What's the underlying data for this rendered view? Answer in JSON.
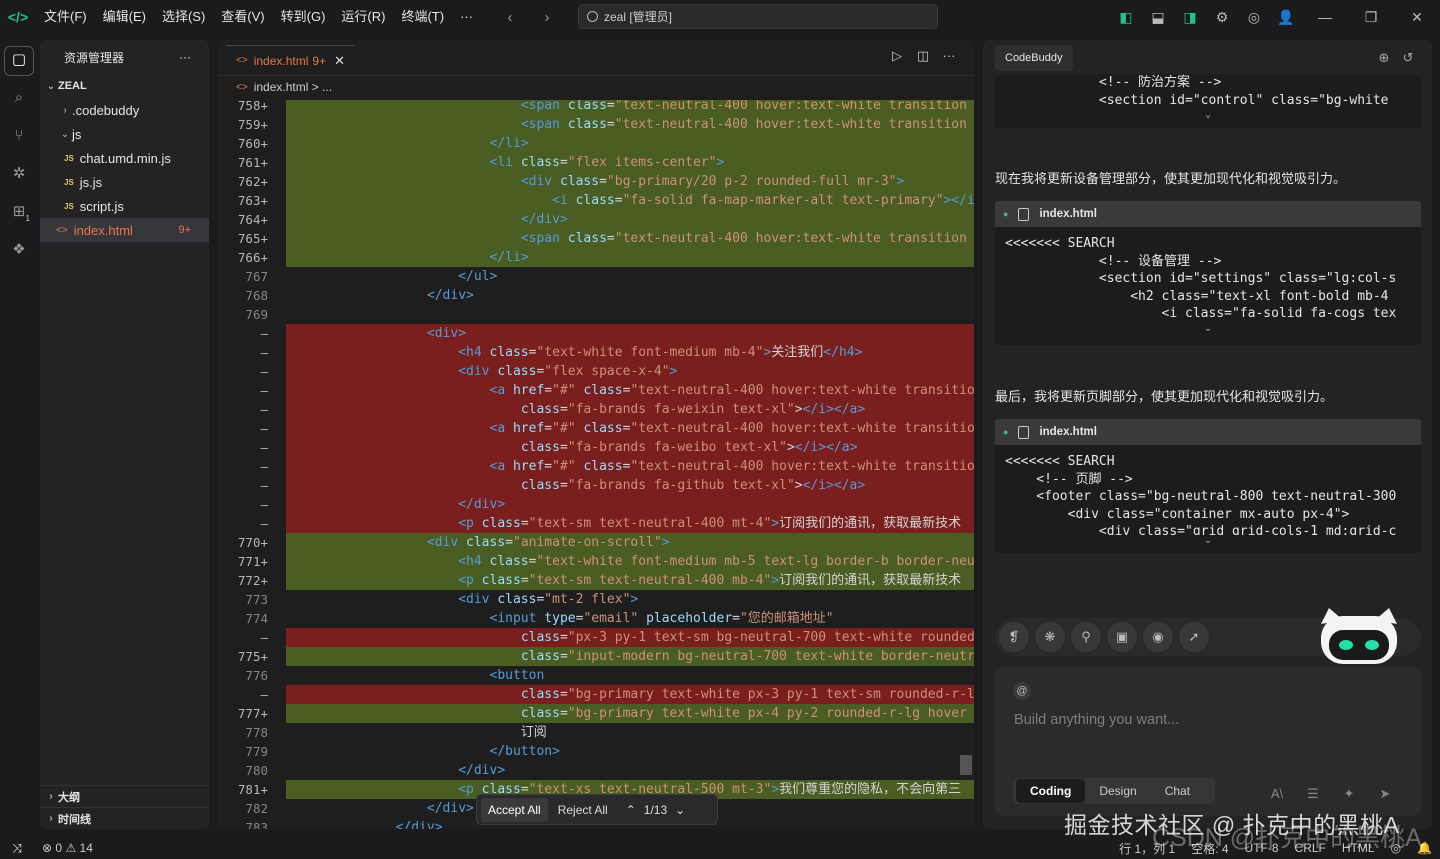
{
  "titlebar": {
    "menus": [
      "文件(F)",
      "编辑(E)",
      "选择(S)",
      "查看(V)",
      "转到(G)",
      "运行(R)",
      "终端(T)",
      "···"
    ],
    "search": "zeal [管理员]"
  },
  "explorer": {
    "title": "资源管理器",
    "more": "···",
    "root": "ZEAL",
    "items": [
      {
        "label": ".codebuddy",
        "type": "folder",
        "indent": 1,
        "open": false
      },
      {
        "label": "js",
        "type": "folder",
        "indent": 1,
        "open": true
      },
      {
        "label": "chat.umd.min.js",
        "type": "js",
        "indent": 2
      },
      {
        "label": "js.js",
        "type": "js",
        "indent": 2
      },
      {
        "label": "script.js",
        "type": "js",
        "indent": 2
      },
      {
        "label": "index.html",
        "type": "html",
        "indent": 1,
        "selected": true,
        "count": "9+"
      }
    ],
    "outline": "大纲",
    "timeline": "时间线"
  },
  "editor": {
    "tab_label": "index.html",
    "tab_count": "9+",
    "breadcrumb": "index.html > ...",
    "lines": [
      {
        "n": "758+",
        "k": "add",
        "h": "                              <span class=\"text-neutral-400 hover:text-white transition"
      },
      {
        "n": "759+",
        "k": "add",
        "h": "                              <span class=\"text-neutral-400 hover:text-white transition"
      },
      {
        "n": "760+",
        "k": "add",
        "h": "                          </li>"
      },
      {
        "n": "761+",
        "k": "add",
        "h": "                          <li class=\"flex items-center\">"
      },
      {
        "n": "762+",
        "k": "add",
        "h": "                              <div class=\"bg-primary/20 p-2 rounded-full mr-3\">"
      },
      {
        "n": "763+",
        "k": "add",
        "h": "                                  <i class=\"fa-solid fa-map-marker-alt text-primary\"></i>"
      },
      {
        "n": "764+",
        "k": "add",
        "h": "                              </div>"
      },
      {
        "n": "765+",
        "k": "add",
        "h": "                              <span class=\"text-neutral-400 hover:text-white transition"
      },
      {
        "n": "766+",
        "k": "add",
        "h": "                          </li>"
      },
      {
        "n": "767",
        "k": "",
        "h": "                      </ul>"
      },
      {
        "n": "768",
        "k": "",
        "h": "                  </div>"
      },
      {
        "n": "769",
        "k": "",
        "h": ""
      },
      {
        "n": "—",
        "k": "del",
        "h": "                  <div>"
      },
      {
        "n": "—",
        "k": "del",
        "h": "                      <h4 class=\"text-white font-medium mb-4\">关注我们</h4>"
      },
      {
        "n": "—",
        "k": "del",
        "h": "                      <div class=\"flex space-x-4\">"
      },
      {
        "n": "—",
        "k": "del",
        "h": "                          <a href=\"#\" class=\"text-neutral-400 hover:text-white transitio"
      },
      {
        "n": "—",
        "k": "del",
        "h": "                              class=\"fa-brands fa-weixin text-xl\"></i></a>"
      },
      {
        "n": "—",
        "k": "del",
        "h": "                          <a href=\"#\" class=\"text-neutral-400 hover:text-white transitio"
      },
      {
        "n": "—",
        "k": "del",
        "h": "                              class=\"fa-brands fa-weibo text-xl\"></i></a>"
      },
      {
        "n": "—",
        "k": "del",
        "h": "                          <a href=\"#\" class=\"text-neutral-400 hover:text-white transitio"
      },
      {
        "n": "—",
        "k": "del",
        "h": "                              class=\"fa-brands fa-github text-xl\"></i></a>"
      },
      {
        "n": "—",
        "k": "del",
        "h": "                      </div>"
      },
      {
        "n": "—",
        "k": "del",
        "h": "                      <p class=\"text-sm text-neutral-400 mt-4\">订阅我们的通讯，获取最新技术"
      },
      {
        "n": "770+",
        "k": "add",
        "h": "                  <div class=\"animate-on-scroll\">"
      },
      {
        "n": "771+",
        "k": "add",
        "h": "                      <h4 class=\"text-white font-medium mb-5 text-lg border-b border-neu"
      },
      {
        "n": "772+",
        "k": "add",
        "h": "                      <p class=\"text-sm text-neutral-400 mb-4\">订阅我们的通讯，获取最新技术"
      },
      {
        "n": "773",
        "k": "",
        "h": "                      <div class=\"mt-2 flex\">"
      },
      {
        "n": "774",
        "k": "",
        "h": "                          <input type=\"email\" placeholder=\"您的邮箱地址\""
      },
      {
        "n": "—",
        "k": "del",
        "h": "                              class=\"px-3 py-1 text-sm bg-neutral-700 text-white rounded"
      },
      {
        "n": "775+",
        "k": "add",
        "h": "                              class=\"input-modern bg-neutral-700 text-white border-neutr"
      },
      {
        "n": "776",
        "k": "",
        "h": "                          <button"
      },
      {
        "n": "—",
        "k": "del",
        "h": "                              class=\"bg-primary text-white px-3 py-1 text-sm rounded-r-l"
      },
      {
        "n": "777+",
        "k": "add",
        "h": "                              class=\"bg-primary text-white px-4 py-2 rounded-r-lg hover"
      },
      {
        "n": "778",
        "k": "",
        "h": "                              订阅"
      },
      {
        "n": "779",
        "k": "",
        "h": "                          </button>"
      },
      {
        "n": "780",
        "k": "",
        "h": "                      </div>"
      },
      {
        "n": "781+",
        "k": "add",
        "h": "                      <p class=\"text-xs text-neutral-500 mt-3\">我们尊重您的隐私，不会向第三"
      },
      {
        "n": "782",
        "k": "",
        "h": "                  </div>"
      },
      {
        "n": "783",
        "k": "",
        "h": "              </div>"
      }
    ],
    "accept_all": "Accept All",
    "reject_all": "Reject All",
    "diff_position": "1/13"
  },
  "codebuddy": {
    "tab": "CodeBuddy",
    "block0_lines": [
      "            <!-- 防治方案 -->",
      "            <section id=\"control\" class=\"bg-white"
    ],
    "msg1": "现在我将更新设备管理部分，使其更加现代化和视觉吸引力。",
    "block1_file": "index.html",
    "block1_lines": [
      "<<<<<<< SEARCH",
      "            <!-- 设备管理 -->",
      "            <section id=\"settings\" class=\"lg:col-s",
      "                <h2 class=\"text-xl font-bold mb-4",
      "                    <i class=\"fa-solid fa-cogs tex"
    ],
    "msg2": "最后，我将更新页脚部分，使其更加现代化和视觉吸引力。",
    "block2_file": "index.html",
    "block2_lines": [
      "<<<<<<< SEARCH",
      "    <!-- 页脚 -->",
      "    <footer class=\"bg-neutral-800 text-neutral-300",
      "        <div class=\"container mx-auto px-4\">",
      "            <div class=\"grid grid-cols-1 md:grid-c"
    ],
    "input_placeholder": "Build anything you want...",
    "modes": [
      "Coding",
      "Design",
      "Chat"
    ]
  },
  "statusbar": {
    "errors": "0",
    "warnings": "14",
    "position": "行 1，列 1",
    "spaces": "空格: 4",
    "encoding": "UTF-8",
    "eol": "CRLF",
    "language": "HTML"
  },
  "watermark": "掘金技术社区 @ 扑克中的黑桃A",
  "watermark2": "CSDN @扑克中的黑桃A",
  "colors": {
    "accent": "#23c18b",
    "added": "#4a5d23",
    "removed": "#7a1e1e",
    "html_orange": "#e5784a"
  }
}
